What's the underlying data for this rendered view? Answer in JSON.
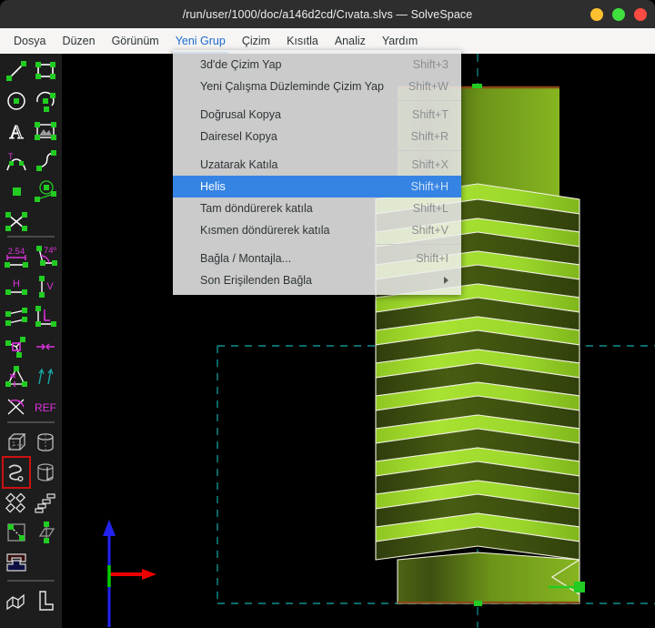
{
  "window": {
    "title": "/run/user/1000/doc/a146d2cd/Cıvata.slvs — SolveSpace",
    "buttons": [
      {
        "name": "minimize",
        "color": "#fdc130"
      },
      {
        "name": "maximize",
        "color": "#3fe13f"
      },
      {
        "name": "close",
        "color": "#fb4b42"
      }
    ]
  },
  "menubar": {
    "items": [
      {
        "label": "Dosya",
        "active": false
      },
      {
        "label": "Düzen",
        "active": false
      },
      {
        "label": "Görünüm",
        "active": false
      },
      {
        "label": "Yeni Grup",
        "active": true
      },
      {
        "label": "Çizim",
        "active": false
      },
      {
        "label": "Kısıtla",
        "active": false
      },
      {
        "label": "Analiz",
        "active": false
      },
      {
        "label": "Yardım",
        "active": false
      }
    ]
  },
  "dropdown": {
    "owner": "Yeni Grup",
    "items": [
      {
        "label": "3d'de Çizim Yap",
        "accel": "Shift+3",
        "highlight": false,
        "submenu": false
      },
      {
        "label": "Yeni Çalışma Düzleminde Çizim Yap",
        "accel": "Shift+W",
        "highlight": false,
        "submenu": false
      },
      {
        "separator": true
      },
      {
        "label": "Doğrusal Kopya",
        "accel": "Shift+T",
        "highlight": false,
        "submenu": false
      },
      {
        "label": "Dairesel Kopya",
        "accel": "Shift+R",
        "highlight": false,
        "submenu": false
      },
      {
        "separator": true
      },
      {
        "label": "Uzatarak Katıla",
        "accel": "Shift+X",
        "highlight": false,
        "submenu": false
      },
      {
        "label": "Helis",
        "accel": "Shift+H",
        "highlight": true,
        "submenu": false
      },
      {
        "label": "Tam döndürerek katıla",
        "accel": "Shift+L",
        "highlight": false,
        "submenu": false
      },
      {
        "label": "Kısmen döndürerek katıla",
        "accel": "Shift+V",
        "highlight": false,
        "submenu": false
      },
      {
        "separator": true
      },
      {
        "label": "Bağla / Montajla...",
        "accel": "Shift+I",
        "highlight": false,
        "submenu": false
      },
      {
        "label": "Son Erişilenden Bağla",
        "accel": "",
        "highlight": false,
        "submenu": true
      }
    ]
  },
  "toolbar": {
    "groups": [
      {
        "name": "draw-entities",
        "tools": [
          {
            "name": "line-tool",
            "selected": false
          },
          {
            "name": "rectangle-tool",
            "selected": false
          },
          {
            "name": "circle-tool",
            "selected": false
          },
          {
            "name": "arc-tool",
            "selected": false
          },
          {
            "name": "text-tool",
            "selected": false
          },
          {
            "name": "image-tool",
            "selected": false
          },
          {
            "name": "tangent-arc-tool",
            "selected": false
          },
          {
            "name": "bezier-curve-tool",
            "selected": false
          },
          {
            "name": "point-tool",
            "selected": false
          },
          {
            "name": "construction-tool",
            "selected": false
          },
          {
            "name": "split-curves-tool",
            "selected": false
          }
        ]
      },
      {
        "name": "constraints",
        "tools": [
          {
            "name": "distance-constraint",
            "label": "2.54",
            "selected": false
          },
          {
            "name": "angle-constraint",
            "label": "74º",
            "selected": false
          },
          {
            "name": "horizontal-constraint",
            "label": "H",
            "selected": false
          },
          {
            "name": "vertical-constraint",
            "label": "V",
            "selected": false
          },
          {
            "name": "parallel-constraint",
            "selected": false
          },
          {
            "name": "perpendicular-constraint",
            "selected": false
          },
          {
            "name": "point-on-entity-constraint",
            "selected": false
          },
          {
            "name": "symmetric-constraint",
            "selected": false
          },
          {
            "name": "equal-constraint",
            "selected": false
          },
          {
            "name": "same-orientation-constraint",
            "selected": false
          },
          {
            "name": "angle-between-constraint",
            "selected": false
          },
          {
            "name": "reference-constraint",
            "label": "REF",
            "selected": false
          }
        ]
      },
      {
        "name": "groups",
        "tools": [
          {
            "name": "extrude-group",
            "selected": false
          },
          {
            "name": "lathe-group",
            "selected": false
          },
          {
            "name": "helix-group",
            "selected": true
          },
          {
            "name": "revolve-group",
            "selected": false
          },
          {
            "name": "step-translate-group",
            "selected": false
          },
          {
            "name": "step-rotate-group",
            "selected": false
          },
          {
            "name": "sketch-in-3d-group",
            "selected": false
          },
          {
            "name": "sketch-in-workplane-group",
            "selected": false
          },
          {
            "name": "assemble-group",
            "selected": false
          }
        ]
      },
      {
        "name": "views",
        "tools": [
          {
            "name": "nearest-iso-view",
            "selected": false
          },
          {
            "name": "nearest-ortho-view",
            "selected": false
          }
        ]
      }
    ]
  },
  "viewport": {
    "model": {
      "name": "threaded-bolt",
      "shank_color": "#7ba81e",
      "thread_light_color": "#9bd62a",
      "thread_dark_color": "#3a4a10",
      "edge_color": "#f0f0dc",
      "thread_turns": 14
    },
    "workplane": {
      "name": "workplane-rectangle",
      "color": "#0f8f8f",
      "style": "dashed"
    },
    "axes": {
      "name": "origin-axes",
      "x_color": "#ee0000",
      "y_color": "#00cc00",
      "z_color": "#2222ee"
    },
    "selected_point": {
      "name": "selected-point",
      "color": "#22cc22"
    }
  }
}
